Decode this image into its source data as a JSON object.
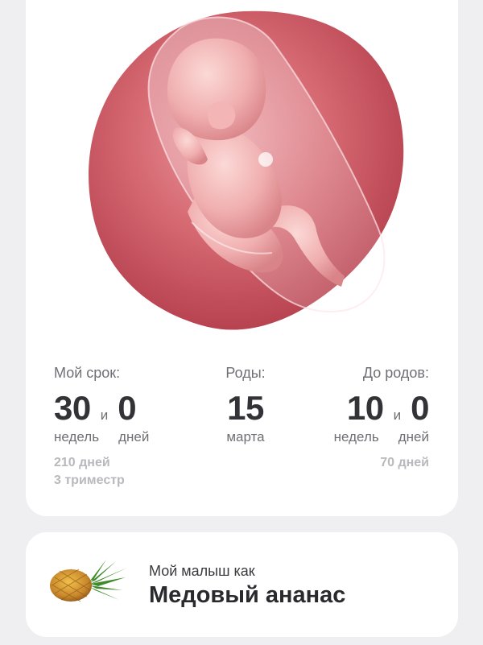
{
  "term": {
    "label": "Мой срок:",
    "weeks": "30",
    "conjunction": "и",
    "days": "0",
    "weeks_unit": "недель",
    "days_unit": "дней",
    "total_days": "210 дней",
    "trimester": "3 триместр"
  },
  "birth": {
    "label": "Роды:",
    "day": "15",
    "month": "марта"
  },
  "until": {
    "label": "До родов:",
    "weeks": "10",
    "conjunction": "и",
    "days": "0",
    "weeks_unit": "недель",
    "days_unit": "дней",
    "total_days": "70 дней"
  },
  "baby": {
    "prefix": "Мой малыш как",
    "size_name": "Медовый ананас",
    "fruit_icon": "pineapple-icon"
  },
  "colors": {
    "background": "#efeff2",
    "card": "#ffffff",
    "womb": "#c8505c"
  }
}
